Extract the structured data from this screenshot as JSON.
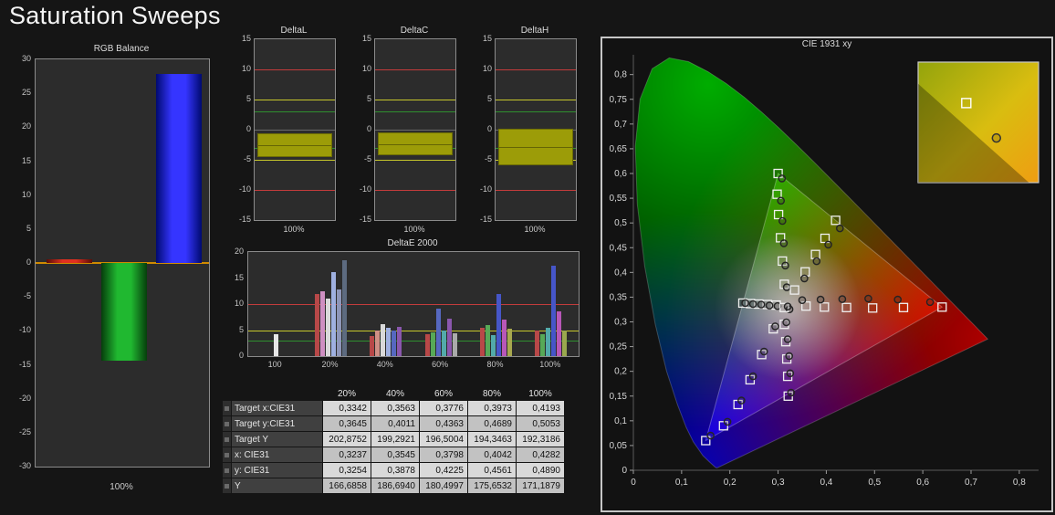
{
  "page": {
    "title": "Saturation Sweeps"
  },
  "table": {
    "headers": [
      "20%",
      "40%",
      "60%",
      "80%",
      "100%"
    ],
    "rows": [
      {
        "label": "Target x:CIE31",
        "values": [
          "0,3342",
          "0,3563",
          "0,3776",
          "0,3973",
          "0,4193"
        ]
      },
      {
        "label": "Target y:CIE31",
        "values": [
          "0,3645",
          "0,4011",
          "0,4363",
          "0,4689",
          "0,5053"
        ]
      },
      {
        "label": "Target Y",
        "values": [
          "202,8752",
          "199,2921",
          "196,5004",
          "194,3463",
          "192,3186"
        ]
      },
      {
        "label": "x: CIE31",
        "values": [
          "0,3237",
          "0,3545",
          "0,3798",
          "0,4042",
          "0,4282"
        ]
      },
      {
        "label": "y: CIE31",
        "values": [
          "0,3254",
          "0,3878",
          "0,4225",
          "0,4561",
          "0,4890"
        ]
      },
      {
        "label": "Y",
        "values": [
          "166,6858",
          "186,6940",
          "180,4997",
          "175,6532",
          "171,1879"
        ]
      }
    ]
  },
  "chart_data": [
    {
      "id": "rgb_balance",
      "type": "bar",
      "title": "RGB Balance",
      "xlabel": "100%",
      "ylim": [
        -30,
        30
      ],
      "yticks": [
        30,
        25,
        20,
        15,
        10,
        5,
        0,
        -5,
        -10,
        -15,
        -20,
        -25,
        -30
      ],
      "zero_line_color": "#d08a00",
      "series": [
        {
          "name": "red",
          "value": 0.5,
          "color": "#e03020",
          "color2": "#5a0c06"
        },
        {
          "name": "green",
          "value": -14.4,
          "color": "#20b830",
          "color2": "#063e0c"
        },
        {
          "name": "blue",
          "value": 27.8,
          "color": "#3535ff",
          "color2": "#000a70"
        }
      ]
    },
    {
      "id": "delta_l",
      "type": "range",
      "title": "DeltaL",
      "xlabel": "100%",
      "ylim": [
        -15,
        15
      ],
      "yticks": [
        15,
        10,
        5,
        0,
        -5,
        -10,
        -15
      ],
      "reference_lines": [
        {
          "value": 10,
          "color": "#c23c3c"
        },
        {
          "value": -10,
          "color": "#c23c3c"
        },
        {
          "value": 5,
          "color": "#c6c62c"
        },
        {
          "value": -5,
          "color": "#c6c62c"
        },
        {
          "value": 3,
          "color": "#2f8f2f"
        },
        {
          "value": -3,
          "color": "#2f8f2f"
        }
      ],
      "box": {
        "from": -0.6,
        "to": -4.2,
        "color": "#9c9c08",
        "border": "#6e6e04"
      }
    },
    {
      "id": "delta_c",
      "type": "range",
      "title": "DeltaC",
      "xlabel": "100%",
      "ylim": [
        -15,
        15
      ],
      "yticks": [
        15,
        10,
        5,
        0,
        -5,
        -10,
        -15
      ],
      "reference_lines": [
        {
          "value": 10,
          "color": "#c23c3c"
        },
        {
          "value": -10,
          "color": "#c23c3c"
        },
        {
          "value": 5,
          "color": "#c6c62c"
        },
        {
          "value": -5,
          "color": "#c6c62c"
        },
        {
          "value": 3,
          "color": "#2f8f2f"
        },
        {
          "value": -3,
          "color": "#2f8f2f"
        }
      ],
      "box": {
        "from": -0.5,
        "to": -4.0,
        "color": "#9c9c08",
        "border": "#6e6e04"
      }
    },
    {
      "id": "delta_h",
      "type": "range",
      "title": "DeltaH",
      "xlabel": "100%",
      "ylim": [
        -15,
        15
      ],
      "yticks": [
        15,
        10,
        5,
        0,
        -5,
        -10,
        -15
      ],
      "reference_lines": [
        {
          "value": 10,
          "color": "#c23c3c"
        },
        {
          "value": -10,
          "color": "#c23c3c"
        },
        {
          "value": 5,
          "color": "#c6c62c"
        },
        {
          "value": -5,
          "color": "#c6c62c"
        },
        {
          "value": 3,
          "color": "#2f8f2f"
        },
        {
          "value": -3,
          "color": "#2f8f2f"
        }
      ],
      "box": {
        "from": 0.2,
        "to": -5.6,
        "color": "#9c9c08",
        "border": "#6e6e04"
      }
    },
    {
      "id": "delta_e",
      "type": "grouped-bar",
      "title": "DeltaE 2000",
      "ylim": [
        0,
        20
      ],
      "yticks": [
        20,
        15,
        10,
        5,
        0
      ],
      "reference_lines": [
        {
          "value": 10,
          "color": "#c23c3c"
        },
        {
          "value": 5,
          "color": "#c6c62c"
        },
        {
          "value": 3,
          "color": "#2f8f2f"
        }
      ],
      "groups": [
        {
          "label": "100",
          "bars": [
            {
              "value": 4.2,
              "color": "#e6e6e6"
            }
          ]
        },
        {
          "label": "20%",
          "bars": [
            {
              "value": 12.0,
              "color": "#b84848"
            },
            {
              "value": 12.4,
              "color": "#cf8fc2"
            },
            {
              "value": 11.0,
              "color": "#d9d9d9"
            },
            {
              "value": 16.1,
              "color": "#9fb0e0"
            },
            {
              "value": 12.9,
              "color": "#8e96b8"
            },
            {
              "value": 18.4,
              "color": "#5d6b80"
            }
          ]
        },
        {
          "label": "40%",
          "bars": [
            {
              "value": 3.9,
              "color": "#b84848"
            },
            {
              "value": 5.0,
              "color": "#cf8f85"
            },
            {
              "value": 6.1,
              "color": "#d9d9d9"
            },
            {
              "value": 5.4,
              "color": "#9fb0e0"
            },
            {
              "value": 4.9,
              "color": "#5668c0"
            },
            {
              "value": 5.6,
              "color": "#8a57ad"
            }
          ]
        },
        {
          "label": "60%",
          "bars": [
            {
              "value": 4.2,
              "color": "#b84848"
            },
            {
              "value": 4.5,
              "color": "#57a957"
            },
            {
              "value": 9.1,
              "color": "#5668c0"
            },
            {
              "value": 5.0,
              "color": "#52aaaa"
            },
            {
              "value": 7.2,
              "color": "#8a57ad"
            },
            {
              "value": 4.4,
              "color": "#aaaaaa"
            }
          ]
        },
        {
          "label": "80%",
          "bars": [
            {
              "value": 5.4,
              "color": "#b84848"
            },
            {
              "value": 6.0,
              "color": "#57a957"
            },
            {
              "value": 4.0,
              "color": "#52aaaa"
            },
            {
              "value": 12.0,
              "color": "#4656c8"
            },
            {
              "value": 7.0,
              "color": "#b857b8"
            },
            {
              "value": 5.2,
              "color": "#a8a84e"
            }
          ]
        },
        {
          "label": "100%",
          "bars": [
            {
              "value": 5.0,
              "color": "#b84848"
            },
            {
              "value": 4.2,
              "color": "#57a957"
            },
            {
              "value": 5.5,
              "color": "#52aaaa"
            },
            {
              "value": 17.3,
              "color": "#4656c8"
            },
            {
              "value": 8.6,
              "color": "#b857b8"
            },
            {
              "value": 5.0,
              "color": "#9aa84e"
            }
          ]
        }
      ]
    },
    {
      "id": "cie",
      "type": "scatter",
      "title": "CIE 1931 xy",
      "xlim": [
        0,
        0.84
      ],
      "ylim": [
        0,
        0.84
      ],
      "xticks": [
        "0",
        "0,1",
        "0,2",
        "0,3",
        "0,4",
        "0,5",
        "0,6",
        "0,7",
        "0,8"
      ],
      "yticks": [
        "0,8",
        "0,75",
        "0,7",
        "0,65",
        "0,6",
        "0,55",
        "0,5",
        "0,45",
        "0,4",
        "0,35",
        "0,3",
        "0,25",
        "0,2",
        "0,15",
        "0,1",
        "0,05",
        "0"
      ],
      "gamut_triangle": [
        [
          0.64,
          0.33
        ],
        [
          0.3,
          0.6
        ],
        [
          0.15,
          0.06
        ]
      ],
      "white_point": {
        "target": [
          0.3127,
          0.329
        ],
        "measured": [
          0.32,
          0.331
        ]
      },
      "sweeps": [
        {
          "name": "red",
          "targets": [
            [
              0.358,
              0.332
            ],
            [
              0.396,
              0.33
            ],
            [
              0.442,
              0.329
            ],
            [
              0.496,
              0.328
            ],
            [
              0.56,
              0.329
            ],
            [
              0.64,
              0.33
            ]
          ],
          "measured": [
            [
              0.35,
              0.344
            ],
            [
              0.388,
              0.345
            ],
            [
              0.433,
              0.346
            ],
            [
              0.487,
              0.347
            ],
            [
              0.548,
              0.345
            ],
            [
              0.615,
              0.34
            ]
          ]
        },
        {
          "name": "green",
          "targets": [
            [
              0.313,
              0.376
            ],
            [
              0.309,
              0.423
            ],
            [
              0.305,
              0.47
            ],
            [
              0.301,
              0.517
            ],
            [
              0.298,
              0.558
            ],
            [
              0.3,
              0.6
            ]
          ],
          "measured": [
            [
              0.318,
              0.37
            ],
            [
              0.315,
              0.414
            ],
            [
              0.312,
              0.459
            ],
            [
              0.309,
              0.504
            ],
            [
              0.306,
              0.545
            ],
            [
              0.308,
              0.59
            ]
          ]
        },
        {
          "name": "blue",
          "targets": [
            [
              0.29,
              0.286
            ],
            [
              0.266,
              0.234
            ],
            [
              0.242,
              0.183
            ],
            [
              0.217,
              0.133
            ],
            [
              0.187,
              0.09
            ],
            [
              0.15,
              0.06
            ]
          ],
          "measured": [
            [
              0.294,
              0.291
            ],
            [
              0.271,
              0.24
            ],
            [
              0.248,
              0.19
            ],
            [
              0.224,
              0.141
            ],
            [
              0.195,
              0.098
            ],
            [
              0.16,
              0.07
            ]
          ]
        },
        {
          "name": "cyan",
          "targets": [
            [
              0.296,
              0.334
            ],
            [
              0.278,
              0.335
            ],
            [
              0.26,
              0.336
            ],
            [
              0.243,
              0.337
            ],
            [
              0.227,
              0.338
            ]
          ],
          "measured": [
            [
              0.299,
              0.332
            ],
            [
              0.282,
              0.333
            ],
            [
              0.265,
              0.335
            ],
            [
              0.248,
              0.336
            ],
            [
              0.232,
              0.338
            ]
          ]
        },
        {
          "name": "magenta",
          "targets": [
            [
              0.313,
              0.295
            ],
            [
              0.316,
              0.26
            ],
            [
              0.318,
              0.225
            ],
            [
              0.32,
              0.19
            ],
            [
              0.321,
              0.15
            ]
          ],
          "measured": [
            [
              0.317,
              0.299
            ],
            [
              0.32,
              0.265
            ],
            [
              0.323,
              0.231
            ],
            [
              0.325,
              0.196
            ],
            [
              0.327,
              0.157
            ]
          ]
        },
        {
          "name": "yellow",
          "targets": [
            [
              0.3342,
              0.3645
            ],
            [
              0.3563,
              0.4011
            ],
            [
              0.3776,
              0.4363
            ],
            [
              0.3973,
              0.4689
            ],
            [
              0.4193,
              0.5053
            ]
          ],
          "measured": [
            [
              0.3237,
              0.3254
            ],
            [
              0.3545,
              0.3878
            ],
            [
              0.3798,
              0.4225
            ],
            [
              0.4042,
              0.4561
            ],
            [
              0.4282,
              0.489
            ]
          ]
        }
      ]
    }
  ]
}
